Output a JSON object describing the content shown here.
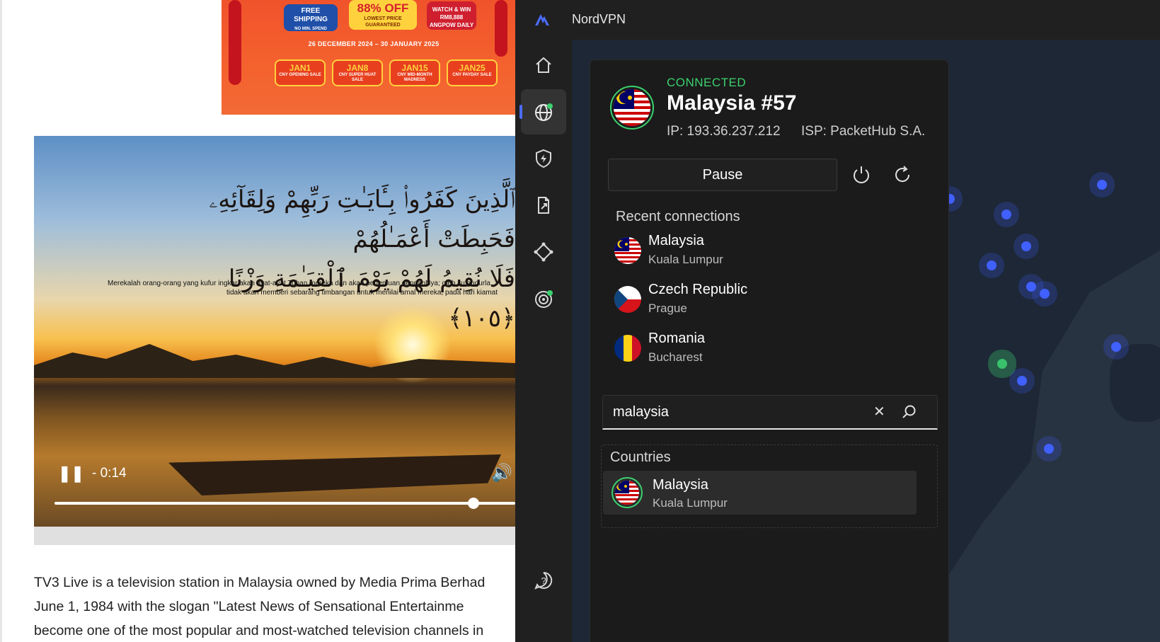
{
  "web": {
    "ad": {
      "free_shipping": "FREE SHIPPING",
      "free_shipping_sub": "NO MIN. SPEND",
      "discount": "88% OFF",
      "discount_sub": "LOWEST PRICE GUARANTEED",
      "win_text": "WATCH & WIN RM8,888 ANGPOW DAILY",
      "date_range": "26 DECEMBER 2024 – 30 JANUARY 2025",
      "tiles": [
        {
          "day": "JAN1",
          "label": "CNY OPENING SALE"
        },
        {
          "day": "JAN8",
          "label": "CNY SUPER HUAT SALE"
        },
        {
          "day": "JAN15",
          "label": "CNY MID-MONTH MADNESS"
        },
        {
          "day": "JAN25",
          "label": "CNY PAYDAY SALE"
        }
      ]
    },
    "video": {
      "arabic_line1": "ٱلَّذِينَ كَفَرُوا۟ بِـَٔايَـٰتِ رَبِّهِمْ وَلِقَآئِهِۦ فَحَبِطَتْ أَعْمَـٰلُهُمْ",
      "arabic_line2": "فَلَا نُقِيمُ لَهُمْ يَوْمَ ٱلْقِيَـٰمَةِ وَزْنًا ﴿١٠٥﴾",
      "subtitle_line1": "Merekalah orang-orang yang kufur ingkar akan ayat-ayat Tuhan mereka dan akan pertemuan denganNya; oleh itu gugurla",
      "subtitle_line2": "tidak akan memberi sebarang timbangan untuk menilai amal mereka, pada hari kiamat",
      "time_remaining": "- 0:14",
      "progress": 0.91
    },
    "article": {
      "line1": "TV3 Live is a television station in Malaysia owned by Media Prima Berhad",
      "line2": "June 1, 1984 with the slogan \"Latest News of Sensational Entertainme",
      "line3": "become one of the most popular and most-watched television channels in"
    }
  },
  "app": {
    "title": "NordVPN",
    "status": "CONNECTED",
    "server": "Malaysia #57",
    "ip": "IP: 193.36.237.212",
    "isp": "ISP: PacketHub S.A.",
    "pause_label": "Pause",
    "recent_title": "Recent connections",
    "recent": [
      {
        "country": "Malaysia",
        "city": "Kuala Lumpur",
        "flag": "malaysia"
      },
      {
        "country": "Czech Republic",
        "city": "Prague",
        "flag": "czech"
      },
      {
        "country": "Romania",
        "city": "Bucharest",
        "flag": "romania"
      }
    ],
    "search_value": "malaysia",
    "results_title": "Countries",
    "result": {
      "country": "Malaysia",
      "city": "Kuala Lumpur"
    },
    "colors": {
      "connected": "#3bd16f",
      "accent": "#4b6cff",
      "map_dot": "#4060ff"
    }
  }
}
